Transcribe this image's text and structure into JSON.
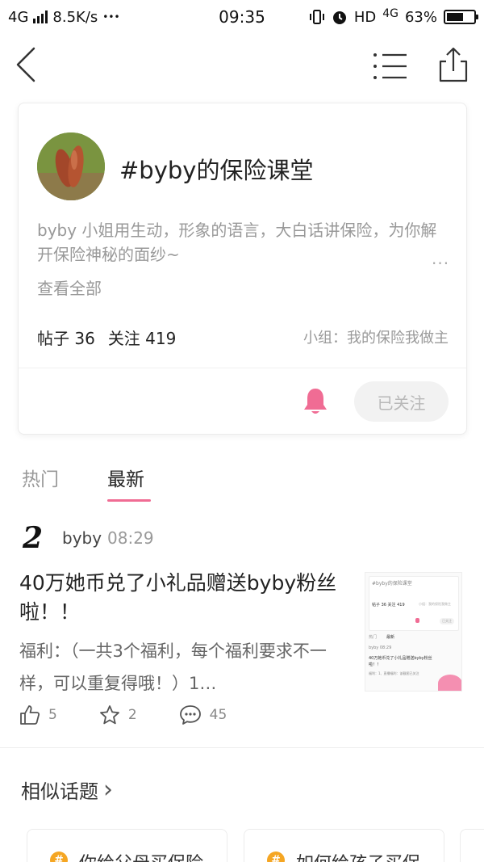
{
  "status_bar": {
    "network_left": "4G",
    "speed": "8.5K/s",
    "dots": "•••",
    "time": "09:35",
    "hd": "HD",
    "network_right": "4G",
    "battery": "63%",
    "battery_level": 0.63
  },
  "topic": {
    "title": "#byby的保险课堂",
    "description": "byby 小姐用生动，形象的语言，大白话讲保险，为你解开保险神秘的面纱~",
    "more": "···",
    "view_all": "查看全部",
    "posts": "帖子 36",
    "followers": "关注 419",
    "group": "小组：我的保险我做主",
    "follow_label": "已关注"
  },
  "tabs": {
    "hot": "热门",
    "latest": "最新"
  },
  "post": {
    "avatar_glyph": "2",
    "author": "byby",
    "time": "08:29",
    "title": "40万她币兑了小礼品赠送byby粉丝啦！！",
    "excerpt": "福利：（一共3个福利，每个福利要求不一样，可以重复得哦！）1…",
    "likes": "5",
    "favorites": "2",
    "comments": "45",
    "thumbnail": {
      "title": "#byby的保险课堂",
      "stats": "帖子 36  关注 419",
      "group": "小组：我的保险我做主",
      "follow": "已关注",
      "tab_hot": "热门",
      "tab_new": "最新",
      "author": "byby 08:29",
      "post_title": "40万她币兑了小礼品赠送byby粉丝啦！！",
      "post_excerpt": "福利：1、直播福利：该截图已关注"
    }
  },
  "similar": {
    "heading": "相似话题",
    "chevron": "›",
    "items": [
      {
        "hash": "#",
        "label": "你给父母买保险"
      },
      {
        "hash": "#",
        "label": "如何给孩子买保"
      },
      {
        "hash": "#",
        "label": ""
      }
    ]
  },
  "colors": {
    "accent": "#f06c94",
    "bell": "#f06c94",
    "hash_badge": "#f5a623"
  }
}
